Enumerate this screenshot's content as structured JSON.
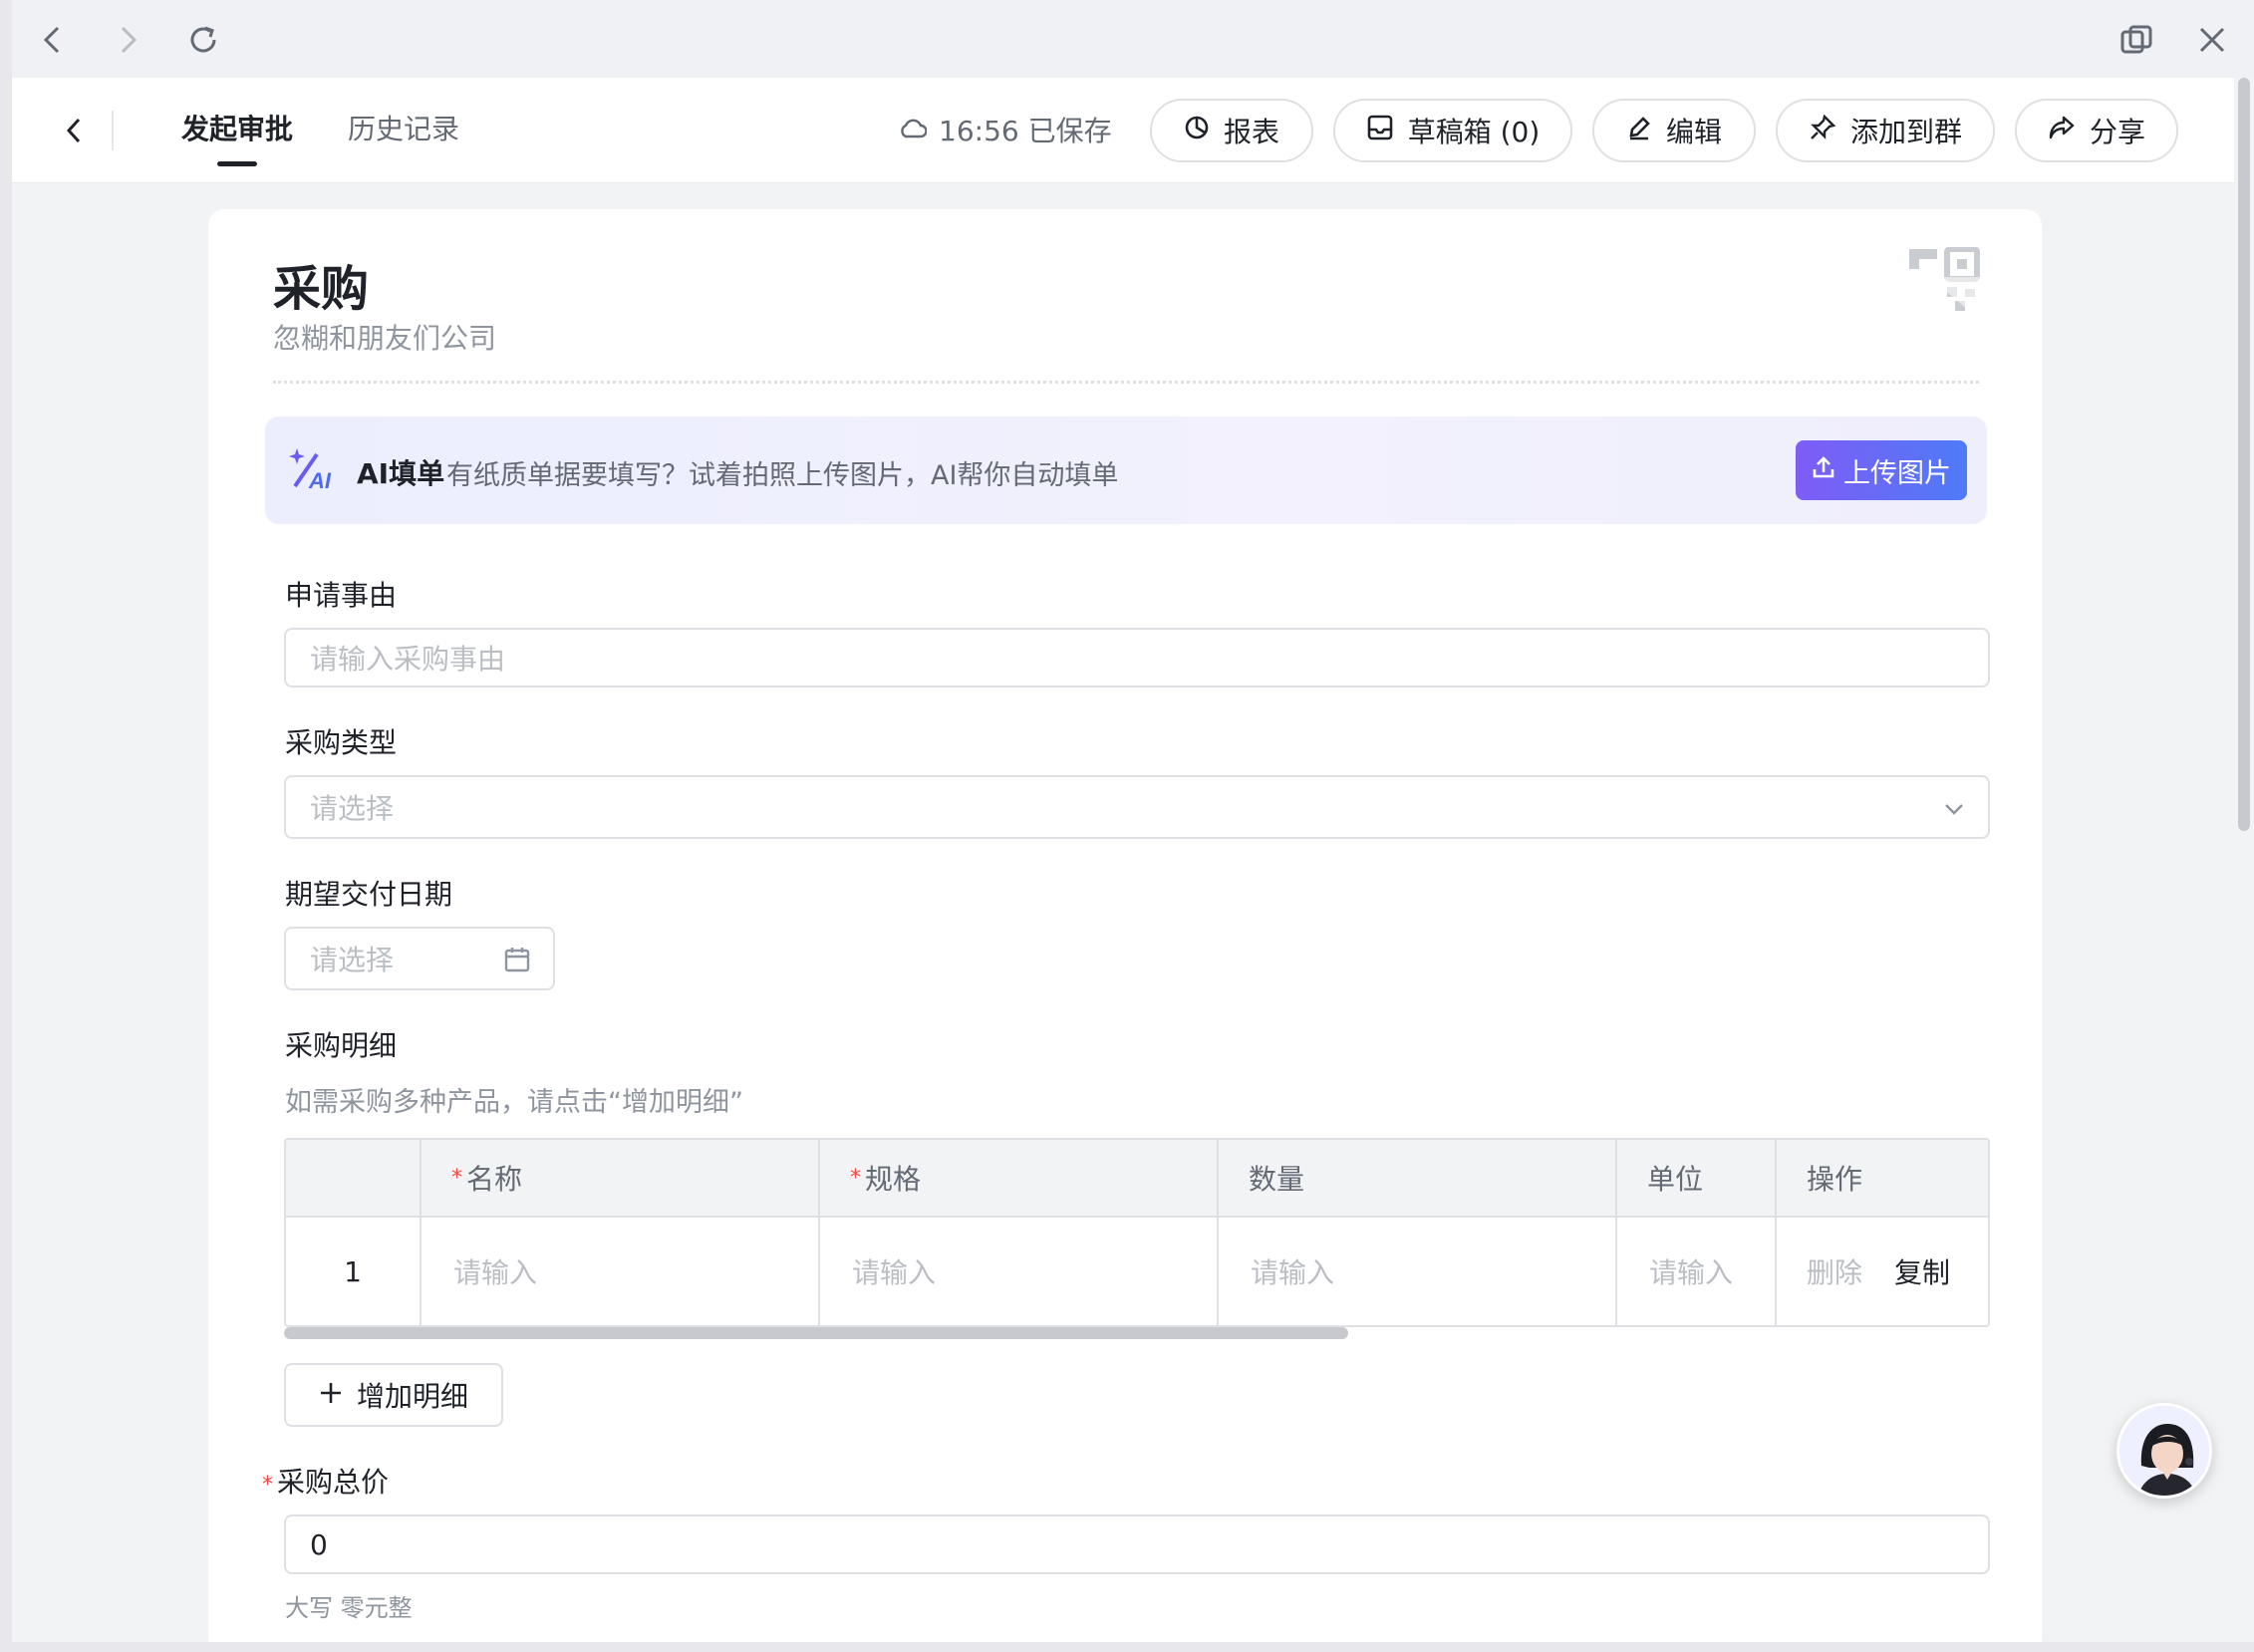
{
  "header": {
    "tabs": [
      {
        "label": "发起审批",
        "active": true
      },
      {
        "label": "历史记录",
        "active": false
      }
    ],
    "saved_status": "16:56 已保存",
    "buttons": {
      "report": "报表",
      "drafts": "草稿箱 (0)",
      "edit": "编辑",
      "add_to_group": "添加到群",
      "share": "分享"
    }
  },
  "form": {
    "title": "采购",
    "company": "忽糊和朋友们公司",
    "ai_banner": {
      "title": "AI填单",
      "description": "有纸质单据要填写？试着拍照上传图片，AI帮你自动填单",
      "upload_label": "上传图片"
    },
    "reason": {
      "label": "申请事由",
      "placeholder": "请输入采购事由"
    },
    "type": {
      "label": "采购类型",
      "placeholder": "请选择"
    },
    "delivery_date": {
      "label": "期望交付日期",
      "placeholder": "请选择"
    },
    "details": {
      "label": "采购明细",
      "hint": "如需采购多种产品，请点击“增加明细”",
      "columns": [
        {
          "label": "名称",
          "required": true
        },
        {
          "label": "规格",
          "required": true
        },
        {
          "label": "数量",
          "required": false
        },
        {
          "label": "单位",
          "required": false
        },
        {
          "label": "操作",
          "required": false
        }
      ],
      "rows": [
        {
          "index": "1",
          "name": "请输入",
          "spec": "请输入",
          "qty": "请输入",
          "unit": "请输入",
          "delete": "删除",
          "copy": "复制"
        }
      ],
      "add_label": "增加明细"
    },
    "total": {
      "label": "采购总价",
      "value": "0",
      "uppercase": "大写 零元整"
    }
  },
  "colors": {
    "accent_gradient_start": "#7f5cf6",
    "accent_gradient_end": "#4e7bf7",
    "required": "#f54a45"
  }
}
